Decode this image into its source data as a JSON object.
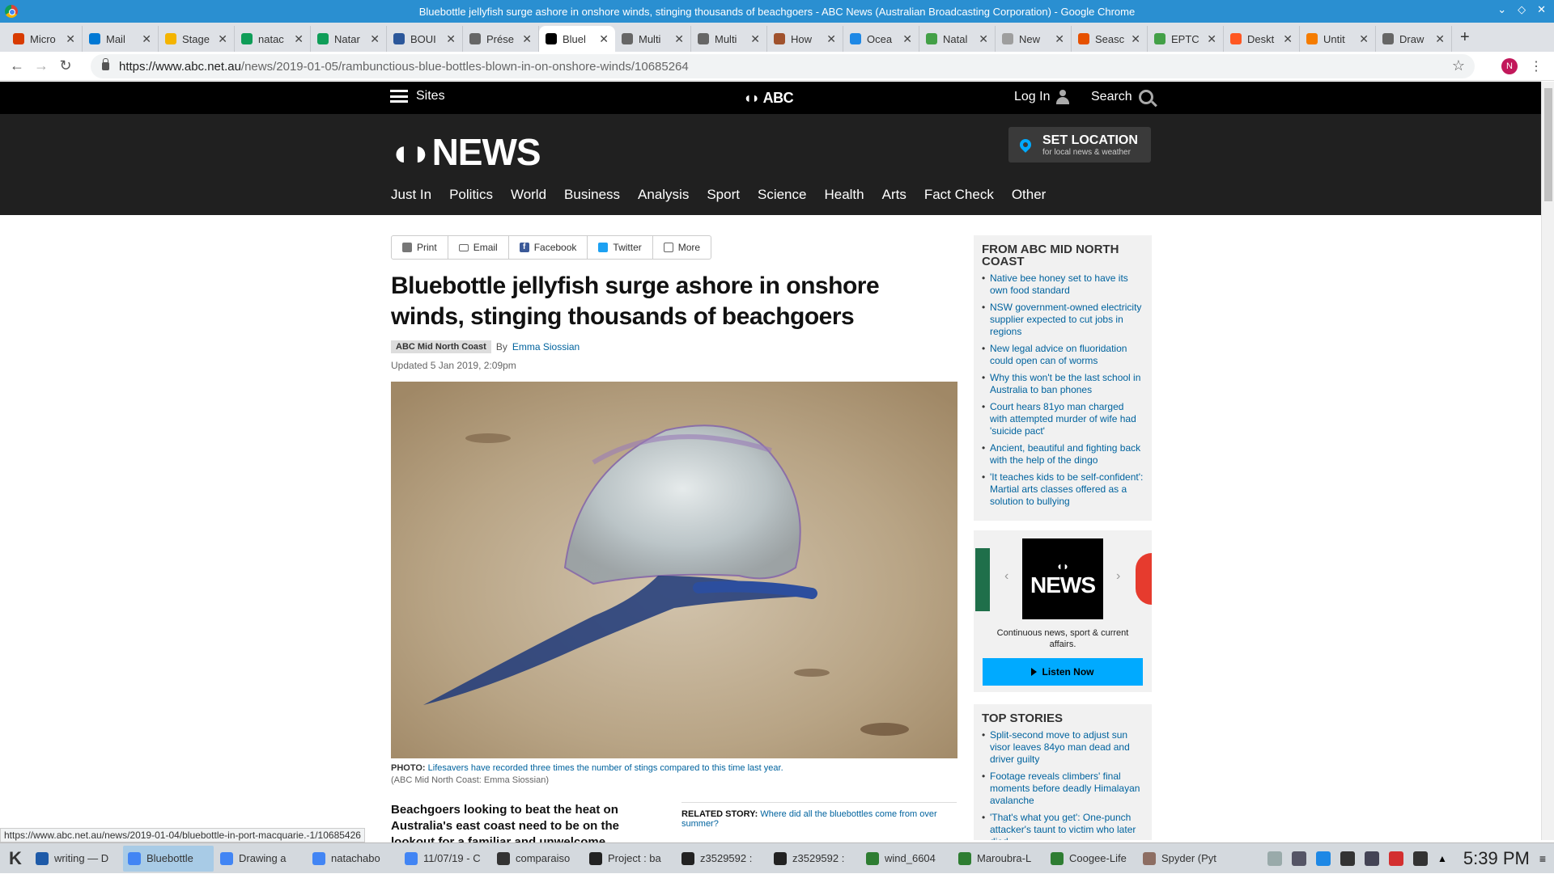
{
  "window": {
    "title": "Bluebottle jellyfish surge ashore in onshore winds, stinging thousands of beachgoers - ABC News (Australian Broadcasting Corporation) - Google Chrome",
    "controls": [
      "⌄",
      "◇",
      "✕"
    ]
  },
  "tabs": [
    {
      "label": "Micro",
      "color": "#d83b01"
    },
    {
      "label": "Mail",
      "color": "#0078d4"
    },
    {
      "label": "Stage",
      "color": "#f4b400"
    },
    {
      "label": "natac",
      "color": "#0f9d58"
    },
    {
      "label": "Natar",
      "color": "#0f9d58"
    },
    {
      "label": "BOUI",
      "color": "#2b579a"
    },
    {
      "label": "Prése",
      "color": "#666666"
    },
    {
      "label": "Bluel",
      "color": "#000000"
    },
    {
      "label": "Multi",
      "color": "#666666"
    },
    {
      "label": "Multi",
      "color": "#666666"
    },
    {
      "label": "How",
      "color": "#a0522d"
    },
    {
      "label": "Ocea",
      "color": "#1e88e5"
    },
    {
      "label": "Natal",
      "color": "#43a047"
    },
    {
      "label": "New",
      "color": "#9e9e9e"
    },
    {
      "label": "Seasc",
      "color": "#e65100"
    },
    {
      "label": "EPTC",
      "color": "#43a047"
    },
    {
      "label": "Deskt",
      "color": "#ff5722"
    },
    {
      "label": "Untit",
      "color": "#f57c00"
    },
    {
      "label": "Draw",
      "color": "#666666"
    }
  ],
  "active_tab_index": 7,
  "omnibox": {
    "host": "https://www.abc.net.au",
    "path": "/news/2019-01-05/rambunctious-blue-bottles-blown-in-on-onshore-winds/10685264",
    "profile_initial": "N"
  },
  "abc_bar": {
    "sites_label": "Sites",
    "logo": "ABC",
    "login_label": "Log In",
    "search_label": "Search"
  },
  "news_header": {
    "logo": "NEWS",
    "set_location": "SET LOCATION",
    "set_location_sub": "for local news & weather",
    "nav": [
      "Just In",
      "Politics",
      "World",
      "Business",
      "Analysis",
      "Sport",
      "Science",
      "Health",
      "Arts",
      "Fact Check",
      "Other"
    ]
  },
  "share": {
    "print": "Print",
    "email": "Email",
    "facebook": "Facebook",
    "twitter": "Twitter",
    "more": "More"
  },
  "article": {
    "headline": "Bluebottle jellyfish surge ashore in onshore winds, stinging thousands of beachgoers",
    "tag": "ABC Mid North Coast",
    "by": "By",
    "author": "Emma Siossian",
    "updated": "Updated 5 Jan 2019, 2:09pm",
    "photo_label": "PHOTO:",
    "photo_caption": "Lifesavers have recorded three times the number of stings compared to this time last year.",
    "photo_credit": "(ABC Mid North Coast: Emma Siossian)",
    "body_start": "Beachgoers looking to beat the heat on Australia's east coast need to be on the lookout for a familiar and unwelcome visitor",
    "related_label": "RELATED STORY:",
    "related_link": "Where did all the bluebottles come from over summer?"
  },
  "sidebar": {
    "local_title": "FROM ABC MID NORTH COAST",
    "local_items": [
      "Native bee honey set to have its own food standard",
      "NSW government-owned electricity supplier expected to cut jobs in regions",
      "New legal advice on fluoridation could open can of worms",
      "Why this won't be the last school in Australia to ban phones",
      "Court hears 81yo man charged with attempted murder of wife had 'suicide pact'",
      "Ancient, beautiful and fighting back with the help of the dingo",
      "'It teaches kids to be self-confident': Martial arts classes offered as a solution to bullying"
    ],
    "radio_logo": "NEWS",
    "radio_desc": "Continuous news, sport & current affairs.",
    "listen_label": "Listen Now",
    "top_title": "TOP STORIES",
    "top_items": [
      "Split-second move to adjust sun visor leaves 84yo man dead and driver guilty",
      "Footage reveals climbers' final moments before deadly Himalayan avalanche",
      "'That's what you get': One-punch attacker's taunt to victim who later died"
    ]
  },
  "status_url": "https://www.abc.net.au/news/2019-01-04/bluebottle-in-port-macquarie.-1/10685426",
  "taskbar": {
    "tasks": [
      {
        "label": "writing — D",
        "color": "#1e5aa8"
      },
      {
        "label": "Bluebottle",
        "color": "#4285f4"
      },
      {
        "label": "Drawing a",
        "color": "#4285f4"
      },
      {
        "label": "natachabo",
        "color": "#4285f4"
      },
      {
        "label": "11/07/19 - C",
        "color": "#4285f4"
      },
      {
        "label": "comparaiso",
        "color": "#333333"
      },
      {
        "label": "Project : ba",
        "color": "#222222"
      },
      {
        "label": "z3529592 :",
        "color": "#222222"
      },
      {
        "label": "z3529592 :",
        "color": "#222222"
      },
      {
        "label": "wind_6604",
        "color": "#2e7d32"
      },
      {
        "label": "Maroubra-L",
        "color": "#2e7d32"
      },
      {
        "label": "Coogee-Life",
        "color": "#2e7d32"
      },
      {
        "label": "Spyder (Pyt",
        "color": "#8d6e63"
      }
    ],
    "active_task_index": 1,
    "clock": "5:39 PM"
  }
}
